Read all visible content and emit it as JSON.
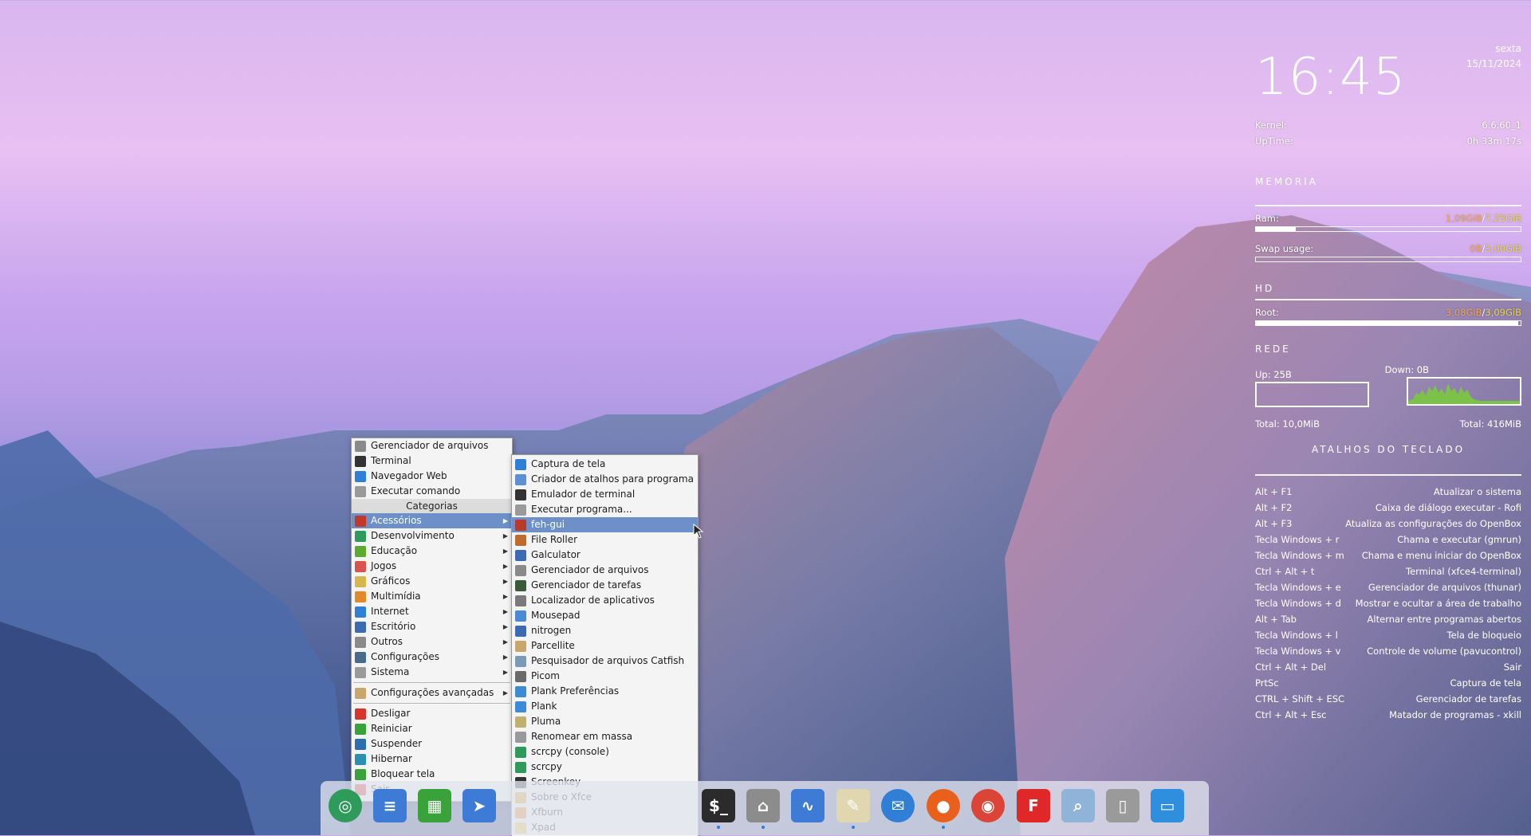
{
  "conky": {
    "day": "sexta",
    "date": "15/11/2024",
    "time": "16:45",
    "kernel_label": "Kernel:",
    "kernel_value": "6.6.60_1",
    "uptime_label": "UpTime:",
    "uptime_value": "0h 33m 17s",
    "memoria_title": "MEMORIA",
    "ram_label": "Ram:",
    "ram_used": "1,09GiB",
    "ram_sep": "/",
    "ram_total": "7,25GiB",
    "ram_fraction": 0.15,
    "swap_label": "Swap usage:",
    "swap_used": "0B",
    "swap_sep": "/",
    "swap_total": "3,00GiB",
    "swap_fraction": 0.0,
    "hd_title": "HD",
    "root_label": "Root:",
    "root_used": "3,08GiB",
    "root_sep": "/",
    "root_total": "3,09GiB",
    "root_fraction": 0.99,
    "rede_title": "REDE",
    "up_label": "Up: 25B",
    "down_label": "Down: 0B",
    "total_up": "Total: 10,0MiB",
    "total_down": "Total: 416MiB",
    "atalhos_title": "ATALHOS DO TECLADO",
    "shortcuts": [
      {
        "key": "Alt + F1",
        "desc": "Atualizar o sistema"
      },
      {
        "key": "Alt + F2",
        "desc": "Caixa de diálogo executar - Rofi"
      },
      {
        "key": "Alt + F3",
        "desc": "Atualiza as configurações do OpenBox"
      },
      {
        "key": "Tecla Windows + r",
        "desc": "Chama e executar (gmrun)"
      },
      {
        "key": "Tecla Windows + m",
        "desc": "Chama e menu iniciar do OpenBox"
      },
      {
        "key": "Ctrl + Alt + t",
        "desc": "Terminal (xfce4-terminal)"
      },
      {
        "key": "Tecla Windows + e",
        "desc": "Gerenciador de arquivos (thunar)"
      },
      {
        "key": "Tecla Windows + d",
        "desc": "Mostrar e ocultar a área de trabalho"
      },
      {
        "key": "Alt + Tab",
        "desc": "Alternar entre programas abertos"
      },
      {
        "key": "Tecla Windows + l",
        "desc": "Tela de bloqueio"
      },
      {
        "key": "Tecla Windows + v",
        "desc": "Controle de volume (pavucontrol)"
      },
      {
        "key": "Ctrl + Alt + Del",
        "desc": "Sair"
      },
      {
        "key": "PrtSc",
        "desc": "Captura de tela"
      },
      {
        "key": "CTRL + Shift + ESC",
        "desc": "Gerenciador de tarefas"
      },
      {
        "key": "Ctrl + Alt + Esc",
        "desc": "Matador de programas - xkill"
      }
    ]
  },
  "main_menu": {
    "top_items": [
      {
        "label": "Gerenciador de arquivos",
        "icon": "folder-icon",
        "color": "#8a8a8a"
      },
      {
        "label": "Terminal",
        "icon": "terminal-icon",
        "color": "#333333"
      },
      {
        "label": "Navegador Web",
        "icon": "globe-icon",
        "color": "#2f7fd6"
      },
      {
        "label": "Executar comando",
        "icon": "gears-icon",
        "color": "#9a9a9a"
      }
    ],
    "categories_header": "Categorias",
    "categories": [
      {
        "label": "Acessórios",
        "icon": "accessories-icon",
        "color": "#c0392b"
      },
      {
        "label": "Desenvolvimento",
        "icon": "development-icon",
        "color": "#2e9b5b"
      },
      {
        "label": "Educação",
        "icon": "education-icon",
        "color": "#5caa2f"
      },
      {
        "label": "Jogos",
        "icon": "games-icon",
        "color": "#d9534f"
      },
      {
        "label": "Gráficos",
        "icon": "graphics-icon",
        "color": "#d6b84a"
      },
      {
        "label": "Multimídia",
        "icon": "multimedia-icon",
        "color": "#e08a2b"
      },
      {
        "label": "Internet",
        "icon": "internet-icon",
        "color": "#2f7fd6"
      },
      {
        "label": "Escritório",
        "icon": "office-icon",
        "color": "#3d6bb3"
      },
      {
        "label": "Outros",
        "icon": "other-icon",
        "color": "#8a8a8a"
      },
      {
        "label": "Configurações",
        "icon": "settings-icon",
        "color": "#4a6a8a"
      },
      {
        "label": "Sistema",
        "icon": "system-icon",
        "color": "#9a9a9a"
      }
    ],
    "advanced": {
      "label": "Configurações avançadas",
      "icon": "advanced-settings-icon",
      "color": "#c9a66b"
    },
    "power_items": [
      {
        "label": "Desligar",
        "icon": "power-icon",
        "color": "#d9342b"
      },
      {
        "label": "Reiniciar",
        "icon": "restart-icon",
        "color": "#3aa23a"
      },
      {
        "label": "Suspender",
        "icon": "suspend-icon",
        "color": "#2b6fb0"
      },
      {
        "label": "Hibernar",
        "icon": "hibernate-icon",
        "color": "#2b8fb0"
      },
      {
        "label": "Bloquear tela",
        "icon": "lock-icon",
        "color": "#3aa23a"
      },
      {
        "label": "Sair",
        "icon": "logout-icon",
        "color": "#d9342b"
      }
    ]
  },
  "sub_menu": {
    "active_index": 4,
    "items": [
      {
        "label": "Captura de tela",
        "icon": "screenshot-icon",
        "color": "#2f7fd6"
      },
      {
        "label": "Criador de atalhos para programa",
        "icon": "shortcut-creator-icon",
        "color": "#5b8fd6"
      },
      {
        "label": "Emulador de terminal",
        "icon": "terminal-icon",
        "color": "#333333"
      },
      {
        "label": "Executar programa...",
        "icon": "run-program-icon",
        "color": "#9a9a9a"
      },
      {
        "label": "feh-gui",
        "icon": "feh-icon",
        "color": "#b83a2b"
      },
      {
        "label": "File Roller",
        "icon": "archive-icon",
        "color": "#c06a2b"
      },
      {
        "label": "Galculator",
        "icon": "calculator-icon",
        "color": "#3d6bb3"
      },
      {
        "label": "Gerenciador de arquivos",
        "icon": "folder-icon",
        "color": "#8a8a8a"
      },
      {
        "label": "Gerenciador de tarefas",
        "icon": "task-manager-icon",
        "color": "#3a5a3a"
      },
      {
        "label": "Localizador de aplicativos",
        "icon": "app-finder-icon",
        "color": "#7a7a7a"
      },
      {
        "label": "Mousepad",
        "icon": "mousepad-icon",
        "color": "#4a8ad6"
      },
      {
        "label": "nitrogen",
        "icon": "nitrogen-icon",
        "color": "#3d6bb3"
      },
      {
        "label": "Parcellite",
        "icon": "parcellite-icon",
        "color": "#c9a66b"
      },
      {
        "label": "Pesquisador de arquivos Catfish",
        "icon": "catfish-icon",
        "color": "#7a9ab8"
      },
      {
        "label": "Picom",
        "icon": "picom-icon",
        "color": "#6a6a6a"
      },
      {
        "label": "Plank Preferências",
        "icon": "plank-prefs-icon",
        "color": "#3d8bd6"
      },
      {
        "label": "Plank",
        "icon": "plank-icon",
        "color": "#3d8bd6"
      },
      {
        "label": "Pluma",
        "icon": "pluma-icon",
        "color": "#c0b070"
      },
      {
        "label": "Renomear em massa",
        "icon": "bulk-rename-icon",
        "color": "#9a9a9a"
      },
      {
        "label": "scrcpy (console)",
        "icon": "scrcpy-console-icon",
        "color": "#2e9b5b"
      },
      {
        "label": "scrcpy",
        "icon": "scrcpy-icon",
        "color": "#2e9b5b"
      },
      {
        "label": "Screenkey",
        "icon": "screenkey-icon",
        "color": "#333333"
      },
      {
        "label": "Sobre o Xfce",
        "icon": "xfce-about-icon",
        "color": "#e0a52b"
      },
      {
        "label": "Xfburn",
        "icon": "xfburn-icon",
        "color": "#e08a2b"
      },
      {
        "label": "Xpad",
        "icon": "xpad-icon",
        "color": "#e6c84a"
      }
    ]
  },
  "dock": {
    "items": [
      {
        "name": "start-menu-icon",
        "color": "#2e9b5b"
      },
      {
        "name": "writer-icon",
        "color": "#3d7bd6"
      },
      {
        "name": "calc-sheet-icon",
        "color": "#3aa23a"
      },
      {
        "name": "arrow-app-icon",
        "color": "#3d7bd6"
      },
      {
        "name": "terminal-icon",
        "color": "#2b2b2b"
      },
      {
        "name": "home-folder-icon",
        "color": "#8c8c8c"
      },
      {
        "name": "system-monitor-icon",
        "color": "#3d7bd6"
      },
      {
        "name": "text-editor-icon",
        "color": "#e0d7b0"
      },
      {
        "name": "mail-client-icon",
        "color": "#2f7fd6"
      },
      {
        "name": "firefox-icon",
        "color": "#e8601c"
      },
      {
        "name": "chrome-icon",
        "color": "#db4437"
      },
      {
        "name": "flipboard-icon",
        "color": "#e12828"
      },
      {
        "name": "search-icon",
        "color": "#8fb4d8"
      },
      {
        "name": "trash-icon",
        "color": "#9a9a9a"
      },
      {
        "name": "desktop-icon",
        "color": "#2f8fdf"
      }
    ]
  }
}
